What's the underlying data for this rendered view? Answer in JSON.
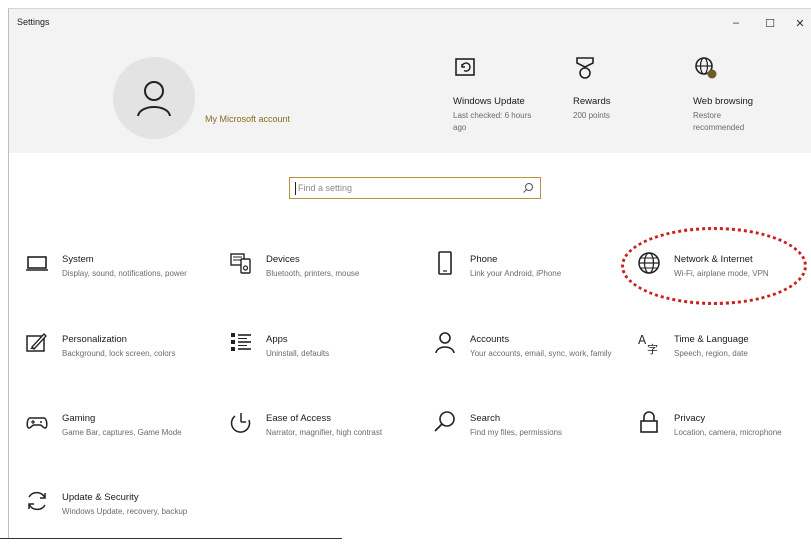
{
  "window": {
    "title": "Settings",
    "minimize": "–",
    "maximize": "☐",
    "close": "✕"
  },
  "header": {
    "account_label": "My Microsoft account",
    "cards": [
      {
        "title": "Windows Update",
        "subtitle": "Last checked: 6 hours ago",
        "icon": "windows-update-icon"
      },
      {
        "title": "Rewards",
        "subtitle": "200 points",
        "icon": "rewards-icon"
      },
      {
        "title": "Web browsing",
        "subtitle": "Restore recommended",
        "icon": "web-browsing-icon"
      }
    ]
  },
  "search": {
    "placeholder": "Find a setting"
  },
  "tiles": [
    {
      "name": "System",
      "desc": "Display, sound, notifications, power",
      "icon": "laptop-icon"
    },
    {
      "name": "Devices",
      "desc": "Bluetooth, printers, mouse",
      "icon": "devices-icon"
    },
    {
      "name": "Phone",
      "desc": "Link your Android, iPhone",
      "icon": "phone-icon"
    },
    {
      "name": "Network & Internet",
      "desc": "Wi-Fi, airplane mode, VPN",
      "icon": "globe-icon"
    },
    {
      "name": "Personalization",
      "desc": "Background, lock screen, colors",
      "icon": "personalization-icon"
    },
    {
      "name": "Apps",
      "desc": "Uninstall, defaults",
      "icon": "apps-icon"
    },
    {
      "name": "Accounts",
      "desc": "Your accounts, email, sync, work, family",
      "icon": "person-icon"
    },
    {
      "name": "Time & Language",
      "desc": "Speech, region, date",
      "icon": "time-language-icon"
    },
    {
      "name": "Gaming",
      "desc": "Game Bar, captures, Game Mode",
      "icon": "gamepad-icon"
    },
    {
      "name": "Ease of Access",
      "desc": "Narrator, magnifier, high contrast",
      "icon": "ease-of-access-icon"
    },
    {
      "name": "Search",
      "desc": "Find my files, permissions",
      "icon": "search-icon"
    },
    {
      "name": "Privacy",
      "desc": "Location, camera, microphone",
      "icon": "lock-icon"
    },
    {
      "name": "Update & Security",
      "desc": "Windows Update, recovery, backup",
      "icon": "sync-icon"
    }
  ],
  "accent_color": "#8a6d1e",
  "annotation_color": "#cc1f1f"
}
